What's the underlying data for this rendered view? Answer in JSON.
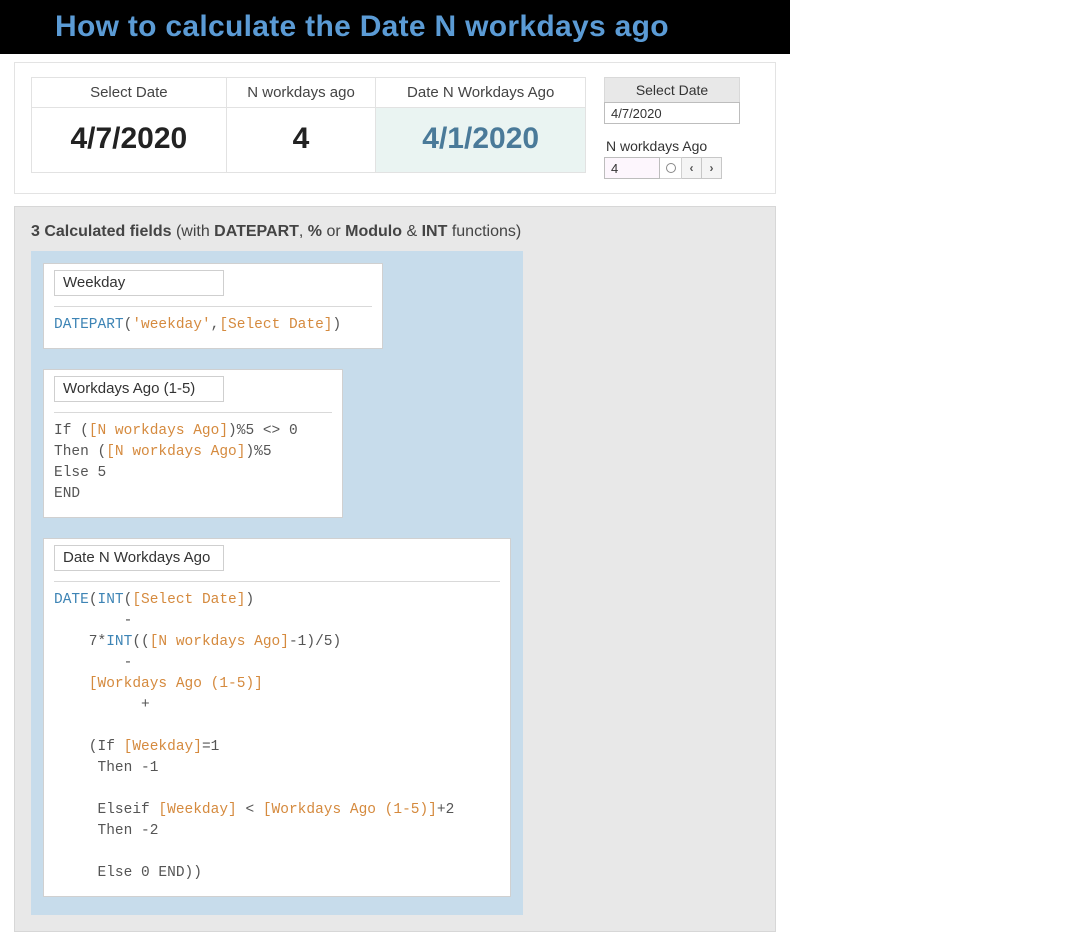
{
  "title": "How to calculate the Date N workdays ago",
  "result_table": {
    "headers": {
      "date": "Select Date",
      "n": "N workdays ago",
      "result": "Date N Workdays Ago"
    },
    "row": {
      "date": "4/7/2020",
      "n": "4",
      "result": "4/1/2020"
    }
  },
  "params": {
    "select_date": {
      "label": "Select Date",
      "value": "4/7/2020"
    },
    "n_workdays": {
      "label": "N workdays Ago",
      "value": "4"
    }
  },
  "calc": {
    "heading_strong": "3 Calculated fields",
    "heading_pre": " (with ",
    "kw1": "DATEPART",
    "sep1": ", ",
    "kw2": "%",
    "sep2": " or ",
    "kw3": "Modulo",
    "sep3": " & ",
    "kw4": "INT",
    "heading_post": " functions)",
    "fields": {
      "a_name": "Weekday",
      "b_name": "Workdays Ago (1-5)",
      "c_name": "Date N Workdays Ago"
    },
    "code_a": {
      "fn": "DATEPART",
      "open": "(",
      "lit": "'weekday'",
      "comma": ",",
      "field": "[Select Date]",
      "close": ")"
    },
    "code_b": {
      "line1_pre": "If (",
      "line1_field": "[N workdays Ago]",
      "line1_post": ")%5 <> 0",
      "line2_pre": "Then (",
      "line2_field": "[N workdays Ago]",
      "line2_post": ")%5",
      "line3": "Else 5",
      "line4": "END"
    },
    "code_c": {
      "l1_fn1": "DATE",
      "l1_mid1": "(",
      "l1_fn2": "INT",
      "l1_mid2": "(",
      "l1_field": "[Select Date]",
      "l1_post": ")",
      "l2_dash": "        -",
      "l3_pre": "    7*",
      "l3_fn": "INT",
      "l3_mid": "((",
      "l3_field": "[N workdays Ago]",
      "l3_post": "-1)/5)",
      "l4_dash": "        -",
      "l5_pre": "    ",
      "l5_field": "[Workdays Ago (1-5)]",
      "l6_plus": "          +",
      "l7_pre": "    (If ",
      "l7_field": "[Weekday]",
      "l7_post": "=1",
      "l8": "     Then -1",
      "l9_pre": "     Elseif ",
      "l9_field1": "[Weekday]",
      "l9_mid": " < ",
      "l9_field2": "[Workdays Ago (1-5)]",
      "l9_post": "+2",
      "l10": "     Then -2",
      "l11": "     Else 0 END))"
    }
  }
}
